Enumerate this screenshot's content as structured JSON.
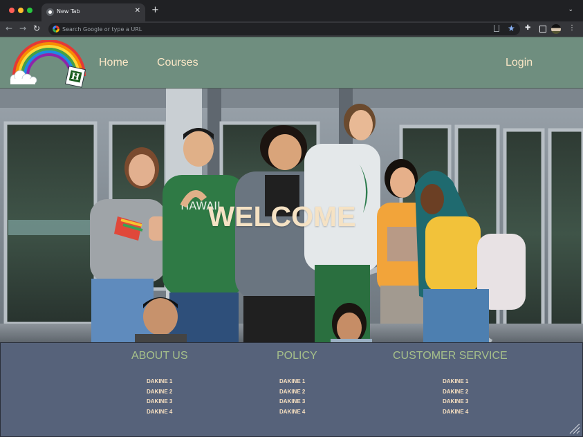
{
  "browser": {
    "tab_title": "New Tab",
    "tab_close": "✕",
    "new_tab": "+",
    "tab_menu": "⌄",
    "back": "←",
    "forward": "→",
    "reload": "↻",
    "omnibox_placeholder": "Search Google or type a URL",
    "star": "★",
    "extensions": "✚",
    "menu": "⋮"
  },
  "header": {
    "nav": {
      "home": "Home",
      "courses": "Courses",
      "login": "Login"
    },
    "logo_letter": "H"
  },
  "hero": {
    "headline": "WELCOME"
  },
  "footer": {
    "columns": [
      {
        "heading": "ABOUT US",
        "items": [
          "DAKINE 1",
          "DAKINE 2",
          "DAKINE 3",
          "DAKINE 4"
        ]
      },
      {
        "heading": "POLICY",
        "items": [
          "DAKINE 1",
          "DAKINE 2",
          "DAKINE 3",
          "DAKINE 4"
        ]
      },
      {
        "heading": "CUSTOMER SERVICE",
        "items": [
          "DAKINE 1",
          "DAKINE 2",
          "DAKINE 3",
          "DAKINE 4"
        ]
      }
    ]
  },
  "colors": {
    "header_bg": "#6f8e7f",
    "nav_text": "#fbe7c6",
    "footer_bg": "#56627a",
    "footer_heading": "#a6c08a",
    "footer_item": "#f6dfc0",
    "welcome_text": "#f5e2c4"
  }
}
